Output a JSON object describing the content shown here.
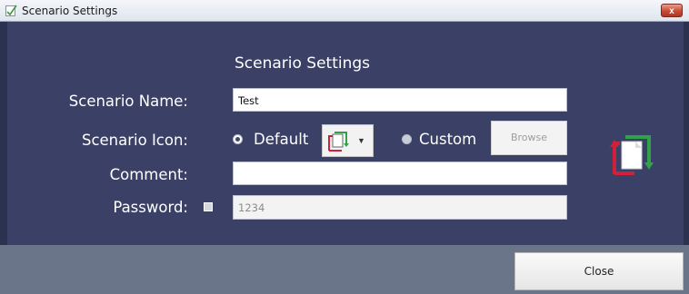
{
  "window": {
    "title": "Scenario Settings",
    "close_glyph": "x"
  },
  "form": {
    "header": "Scenario Settings",
    "name_label": "Scenario Name:",
    "name_value": "Test",
    "icon_label": "Scenario Icon:",
    "icon_default_label": "Default",
    "icon_custom_label": "Custom",
    "icon_selected": "Default",
    "browse_label": "Browse",
    "comment_label": "Comment:",
    "comment_value": "",
    "password_label": "Password:",
    "password_enabled": false,
    "password_value": "1234"
  },
  "footer": {
    "close_label": "Close"
  },
  "colors": {
    "content_bg": "#3b4066",
    "footer_bg": "#6b7589",
    "icon_green": "#2fa24a",
    "icon_red": "#d1203a"
  },
  "icons": [
    "app-icon",
    "scenario-icon",
    "dropdown-caret-icon",
    "close-icon"
  ]
}
